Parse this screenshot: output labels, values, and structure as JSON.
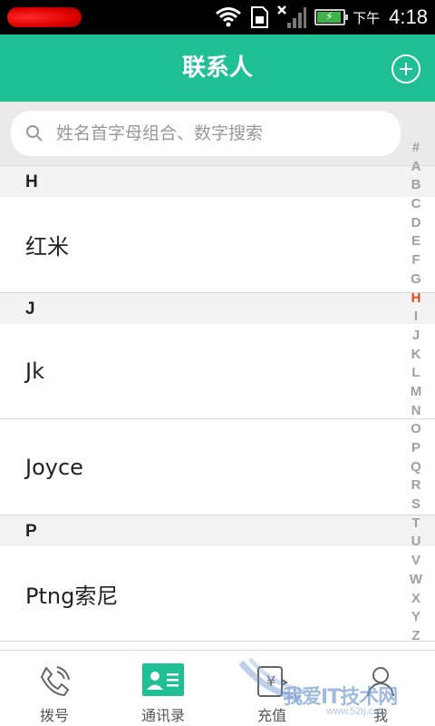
{
  "status_bar": {
    "ampm": "下午",
    "time": "4:18"
  },
  "header": {
    "title": "联系人"
  },
  "search": {
    "placeholder": "姓名首字母组合、数字搜索"
  },
  "sections": [
    {
      "letter": "H",
      "contacts": [
        "红米"
      ]
    },
    {
      "letter": "J",
      "contacts": [
        "Jk",
        "Joyce"
      ]
    },
    {
      "letter": "P",
      "contacts": [
        "Ptng索尼"
      ]
    }
  ],
  "index": {
    "letters": [
      "#",
      "A",
      "B",
      "C",
      "D",
      "E",
      "F",
      "G",
      "H",
      "I",
      "J",
      "K",
      "L",
      "M",
      "N",
      "O",
      "P",
      "Q",
      "R",
      "S",
      "T",
      "U",
      "V",
      "W",
      "X",
      "Y",
      "Z"
    ],
    "active": "H",
    "active_color": "#e8471f"
  },
  "tabs": [
    {
      "label": "拨号",
      "icon": "phone-icon"
    },
    {
      "label": "通讯录",
      "icon": "contacts-card-icon",
      "active": true
    },
    {
      "label": "充值",
      "icon": "recharge-icon"
    },
    {
      "label": "我",
      "icon": "person-icon"
    }
  ],
  "watermark": {
    "text": "我爱IT技术网",
    "sub": "www.52ij.com"
  },
  "colors": {
    "accent": "#1ec094",
    "section_bg": "#f3f3f3"
  }
}
